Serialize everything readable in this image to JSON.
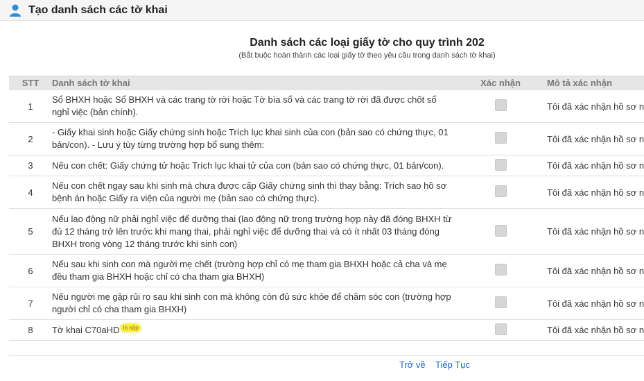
{
  "header": {
    "title": "Tạo danh sách các tờ khai",
    "icon": "user-icon",
    "accent": "#2a8fd6"
  },
  "main": {
    "title": "Danh sách các loại giấy tờ cho quy trình 202",
    "subtitle": "(Bắt buộc hoàn thành các loại giấy tờ theo yêu cầu trong danh sách tờ khai)"
  },
  "table": {
    "columns": {
      "stt": "STT",
      "doc": "Danh sách tờ khai",
      "confirm": "Xác nhận",
      "desc": "Mô tả xác nhận"
    },
    "rows": [
      {
        "stt": "1",
        "doc": "Sổ BHXH hoặc Sổ BHXH và các trang tờ rời hoặc Tờ bìa sổ và các trang tờ rời đã được chốt sổ nghỉ việc (bản chính).",
        "desc": "Tôi đã xác nhận hồ sơ này",
        "checked": false
      },
      {
        "stt": "2",
        "doc": "- Giấy khai sinh hoặc Giấy chứng sinh hoặc Trích lục khai sinh của con (bản sao có chứng thực, 01 bản/con). - Lưu ý tùy từng trường hợp bổ sung thêm:",
        "desc": "Tôi đã xác nhận hồ sơ này",
        "checked": false
      },
      {
        "stt": "3",
        "doc": "Nếu con chết: Giấy chứng tử hoặc Trích lục khai tử của con (bản sao có chứng thực, 01 bản/con).",
        "desc": "Tôi đã xác nhận hồ sơ này",
        "checked": false
      },
      {
        "stt": "4",
        "doc": "Nếu con chết ngay sau khi sinh mà chưa được cấp Giấy chứng sinh thì thay bằng: Trích sao hồ sơ bệnh án hoặc Giấy ra viện của người mẹ (bản sao có chứng thực).",
        "desc": "Tôi đã xác nhận hồ sơ này",
        "checked": false
      },
      {
        "stt": "5",
        "doc": "Nếu lao động nữ phải nghỉ việc để dưỡng thai (lao động nữ trong trường hợp này đã đóng BHXH từ đủ 12 tháng trở lên trước khi mang thai, phải nghỉ việc để dưỡng thai và có ít nhất 03 tháng đóng BHXH trong vòng 12 tháng trước khi sinh con)",
        "desc": "Tôi đã xác nhận hồ sơ này",
        "checked": false
      },
      {
        "stt": "6",
        "doc": "Nếu sau khi sinh con mà người mẹ chết (trường hợp chỉ có mẹ tham gia BHXH hoặc cả cha và mẹ đều tham gia BHXH hoặc chỉ có cha tham gia BHXH)",
        "desc": "Tôi đã xác nhận hồ sơ này",
        "checked": false
      },
      {
        "stt": "7",
        "doc": "Nếu người mẹ gặp rủi ro sau khi sinh con mà không còn đủ sức khỏe để chăm sóc con (trường hợp người chỉ có cha tham gia BHXH)",
        "desc": "Tôi đã xác nhận hồ sơ này",
        "checked": false
      },
      {
        "stt": "8",
        "doc": "Tờ khai C70aHD",
        "badge": "In nộp",
        "desc": "Tôi đã xác nhận hồ sơ này",
        "checked": false
      }
    ]
  },
  "footer": {
    "back_label": "Trở về",
    "next_label": "Tiếp Tục",
    "link_color": "#1a66c8"
  }
}
